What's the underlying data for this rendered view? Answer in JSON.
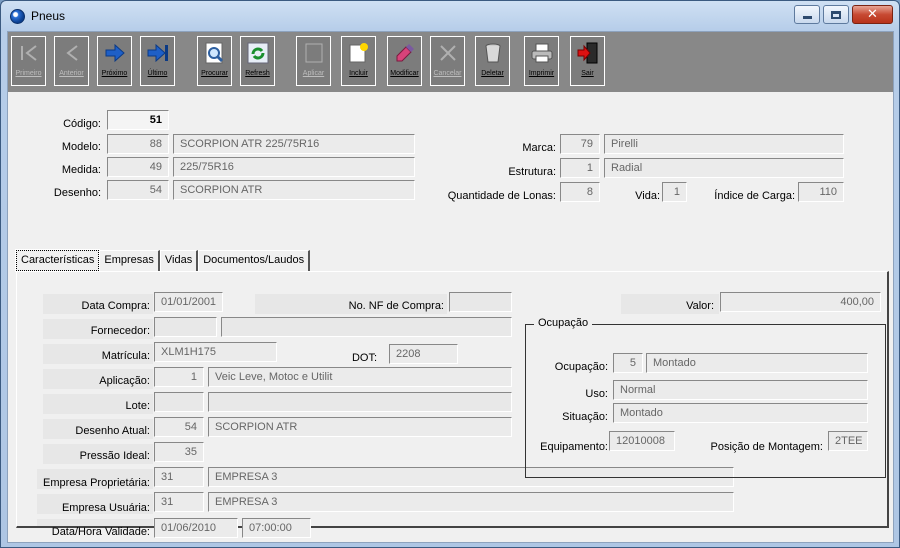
{
  "window": {
    "title": "Pneus"
  },
  "toolbar": [
    {
      "label": "Primeiro",
      "icon": "first-record-icon",
      "enabled": false
    },
    {
      "label": "Anterior",
      "icon": "previous-record-icon",
      "enabled": false
    },
    {
      "label": "Próximo",
      "icon": "next-record-icon",
      "enabled": true
    },
    {
      "label": "Último",
      "icon": "last-record-icon",
      "enabled": true
    },
    {
      "label": "Procurar",
      "icon": "search-icon",
      "enabled": true
    },
    {
      "label": "Refresh",
      "icon": "refresh-icon",
      "enabled": true
    },
    {
      "label": "Aplicar",
      "icon": "apply-icon",
      "enabled": false
    },
    {
      "label": "Incluir",
      "icon": "insert-icon",
      "enabled": true
    },
    {
      "label": "Modificar",
      "icon": "edit-icon",
      "enabled": true
    },
    {
      "label": "Cancelar",
      "icon": "cancel-icon",
      "enabled": false
    },
    {
      "label": "Deletar",
      "icon": "trash-icon",
      "enabled": true
    },
    {
      "label": "Imprimir",
      "icon": "printer-icon",
      "enabled": true
    },
    {
      "label": "Sair",
      "icon": "exit-icon",
      "enabled": true
    }
  ],
  "header": {
    "codigo": {
      "label": "Código:",
      "value": "51"
    },
    "modelo": {
      "label": "Modelo:",
      "code": "88",
      "name": "SCORPION ATR 225/75R16"
    },
    "medida": {
      "label": "Medida:",
      "code": "49",
      "name": "225/75R16"
    },
    "desenho": {
      "label": "Desenho:",
      "code": "54",
      "name": "SCORPION ATR"
    },
    "marca": {
      "label": "Marca:",
      "code": "79",
      "name": "Pirelli"
    },
    "estrutura": {
      "label": "Estrutura:",
      "code": "1",
      "name": "Radial"
    },
    "quantidade_lonas": {
      "label": "Quantidade de Lonas:",
      "value": "8"
    },
    "vida": {
      "label": "Vida:",
      "value": "1"
    },
    "indice_carga": {
      "label": "Índice de Carga:",
      "value": "110"
    }
  },
  "tabs": [
    {
      "label": "Características",
      "active": true
    },
    {
      "label": "Empresas",
      "active": false
    },
    {
      "label": "Vidas",
      "active": false
    },
    {
      "label": "Documentos/Laudos",
      "active": false
    }
  ],
  "caracteristicas": {
    "data_compra": {
      "label": "Data Compra:",
      "value": "01/01/2001"
    },
    "nf_compra": {
      "label": "No. NF de Compra:",
      "value": ""
    },
    "valor": {
      "label": "Valor:",
      "value": "400,00"
    },
    "fornecedor": {
      "label": "Fornecedor:",
      "code": "",
      "name": ""
    },
    "matricula": {
      "label": "Matrícula:",
      "value": "XLM1H175"
    },
    "dot": {
      "label": "DOT:",
      "value": "2208"
    },
    "aplicacao": {
      "label": "Aplicação:",
      "code": "1",
      "name": "Veic Leve, Motoc e Utilit"
    },
    "lote": {
      "label": "Lote:",
      "code": "",
      "name": ""
    },
    "desenho_atual": {
      "label": "Desenho Atual:",
      "code": "54",
      "name": "SCORPION ATR"
    },
    "pressao_ideal": {
      "label": "Pressão Ideal:",
      "value": "35"
    },
    "empresa_proprietaria": {
      "label": "Empresa Proprietária:",
      "code": "31",
      "name": "EMPRESA 3"
    },
    "empresa_usuaria": {
      "label": "Empresa Usuária:",
      "code": "31",
      "name": "EMPRESA 3"
    },
    "validade": {
      "label": "Data/Hora Validade:",
      "date": "01/06/2010",
      "time": "07:00:00"
    }
  },
  "ocupacao_group": {
    "title": "Ocupação",
    "ocupacao": {
      "label": "Ocupação:",
      "code": "5",
      "name": "Montado"
    },
    "uso": {
      "label": "Uso:",
      "value": "Normal"
    },
    "situacao": {
      "label": "Situação:",
      "value": "Montado"
    },
    "equipamento": {
      "label": "Equipamento:",
      "value": "12010008"
    },
    "posicao": {
      "label": "Posição de Montagem:",
      "value": "2TEE"
    }
  }
}
